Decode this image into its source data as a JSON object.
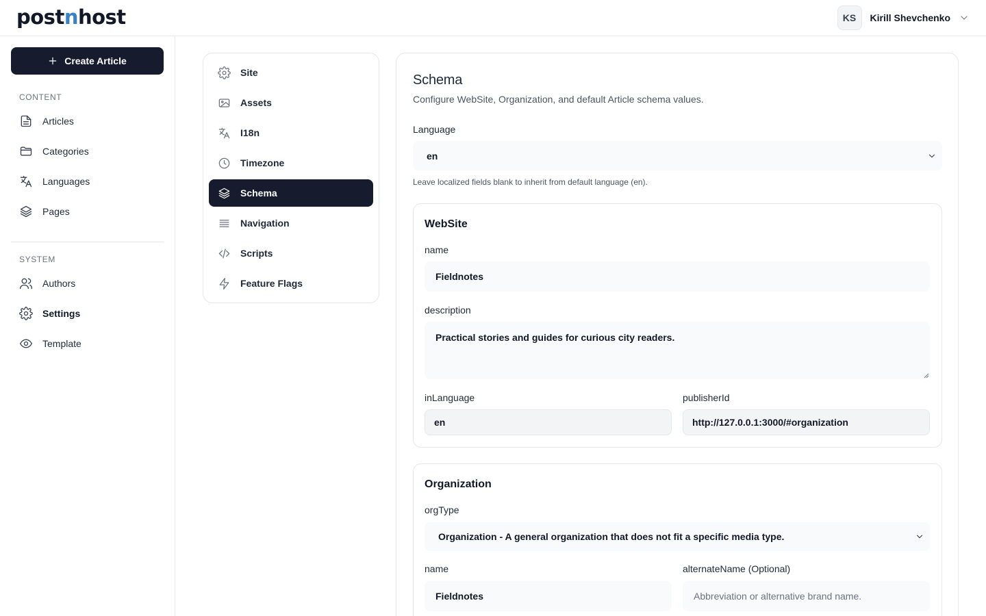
{
  "header": {
    "logo_part1": "post",
    "logo_accent": "n",
    "logo_part2": "host",
    "user_initials": "KS",
    "user_name": "Kirill Shevchenko"
  },
  "sidebar": {
    "create_label": "Create Article",
    "content_section": "CONTENT",
    "content_items": [
      {
        "label": "Articles",
        "icon": "file-icon"
      },
      {
        "label": "Categories",
        "icon": "folder-icon"
      },
      {
        "label": "Languages",
        "icon": "translate-icon"
      },
      {
        "label": "Pages",
        "icon": "layers-icon"
      }
    ],
    "system_section": "SYSTEM",
    "system_items": [
      {
        "label": "Authors",
        "icon": "users-icon"
      },
      {
        "label": "Settings",
        "icon": "gear-icon"
      },
      {
        "label": "Template",
        "icon": "eye-icon"
      }
    ]
  },
  "settings_menu": [
    {
      "label": "Site",
      "icon": "gear-icon"
    },
    {
      "label": "Assets",
      "icon": "image-icon"
    },
    {
      "label": "I18n",
      "icon": "translate-icon"
    },
    {
      "label": "Timezone",
      "icon": "clock-icon"
    },
    {
      "label": "Schema",
      "icon": "layers-icon"
    },
    {
      "label": "Navigation",
      "icon": "menu-lines-icon"
    },
    {
      "label": "Scripts",
      "icon": "code-icon"
    },
    {
      "label": "Feature Flags",
      "icon": "bolt-icon"
    }
  ],
  "schema": {
    "title": "Schema",
    "subtitle": "Configure WebSite, Organization, and default Article schema values.",
    "language_label": "Language",
    "language_value": "en",
    "language_hint": "Leave localized fields blank to inherit from default language (en).",
    "website": {
      "title": "WebSite",
      "name_label": "name",
      "name_value": "Fieldnotes",
      "description_label": "description",
      "description_value": "Practical stories and guides for curious city readers.",
      "inlanguage_label": "inLanguage",
      "inlanguage_value": "en",
      "publisherid_label": "publisherId",
      "publisherid_value": "http://127.0.0.1:3000/#organization"
    },
    "organization": {
      "title": "Organization",
      "orgtype_label": "orgType",
      "orgtype_value": "Organization - A general organization that does not fit a specific media type.",
      "name_label": "name",
      "name_value": "Fieldnotes",
      "altname_label": "alternateName (Optional)",
      "altname_placeholder": "Abbreviation or alternative brand name."
    }
  },
  "colors": {
    "primary_dark": "#161b2e",
    "logo_accent": "#3b82c4",
    "border": "#e5e7eb",
    "field_bg": "#f9fafb"
  }
}
